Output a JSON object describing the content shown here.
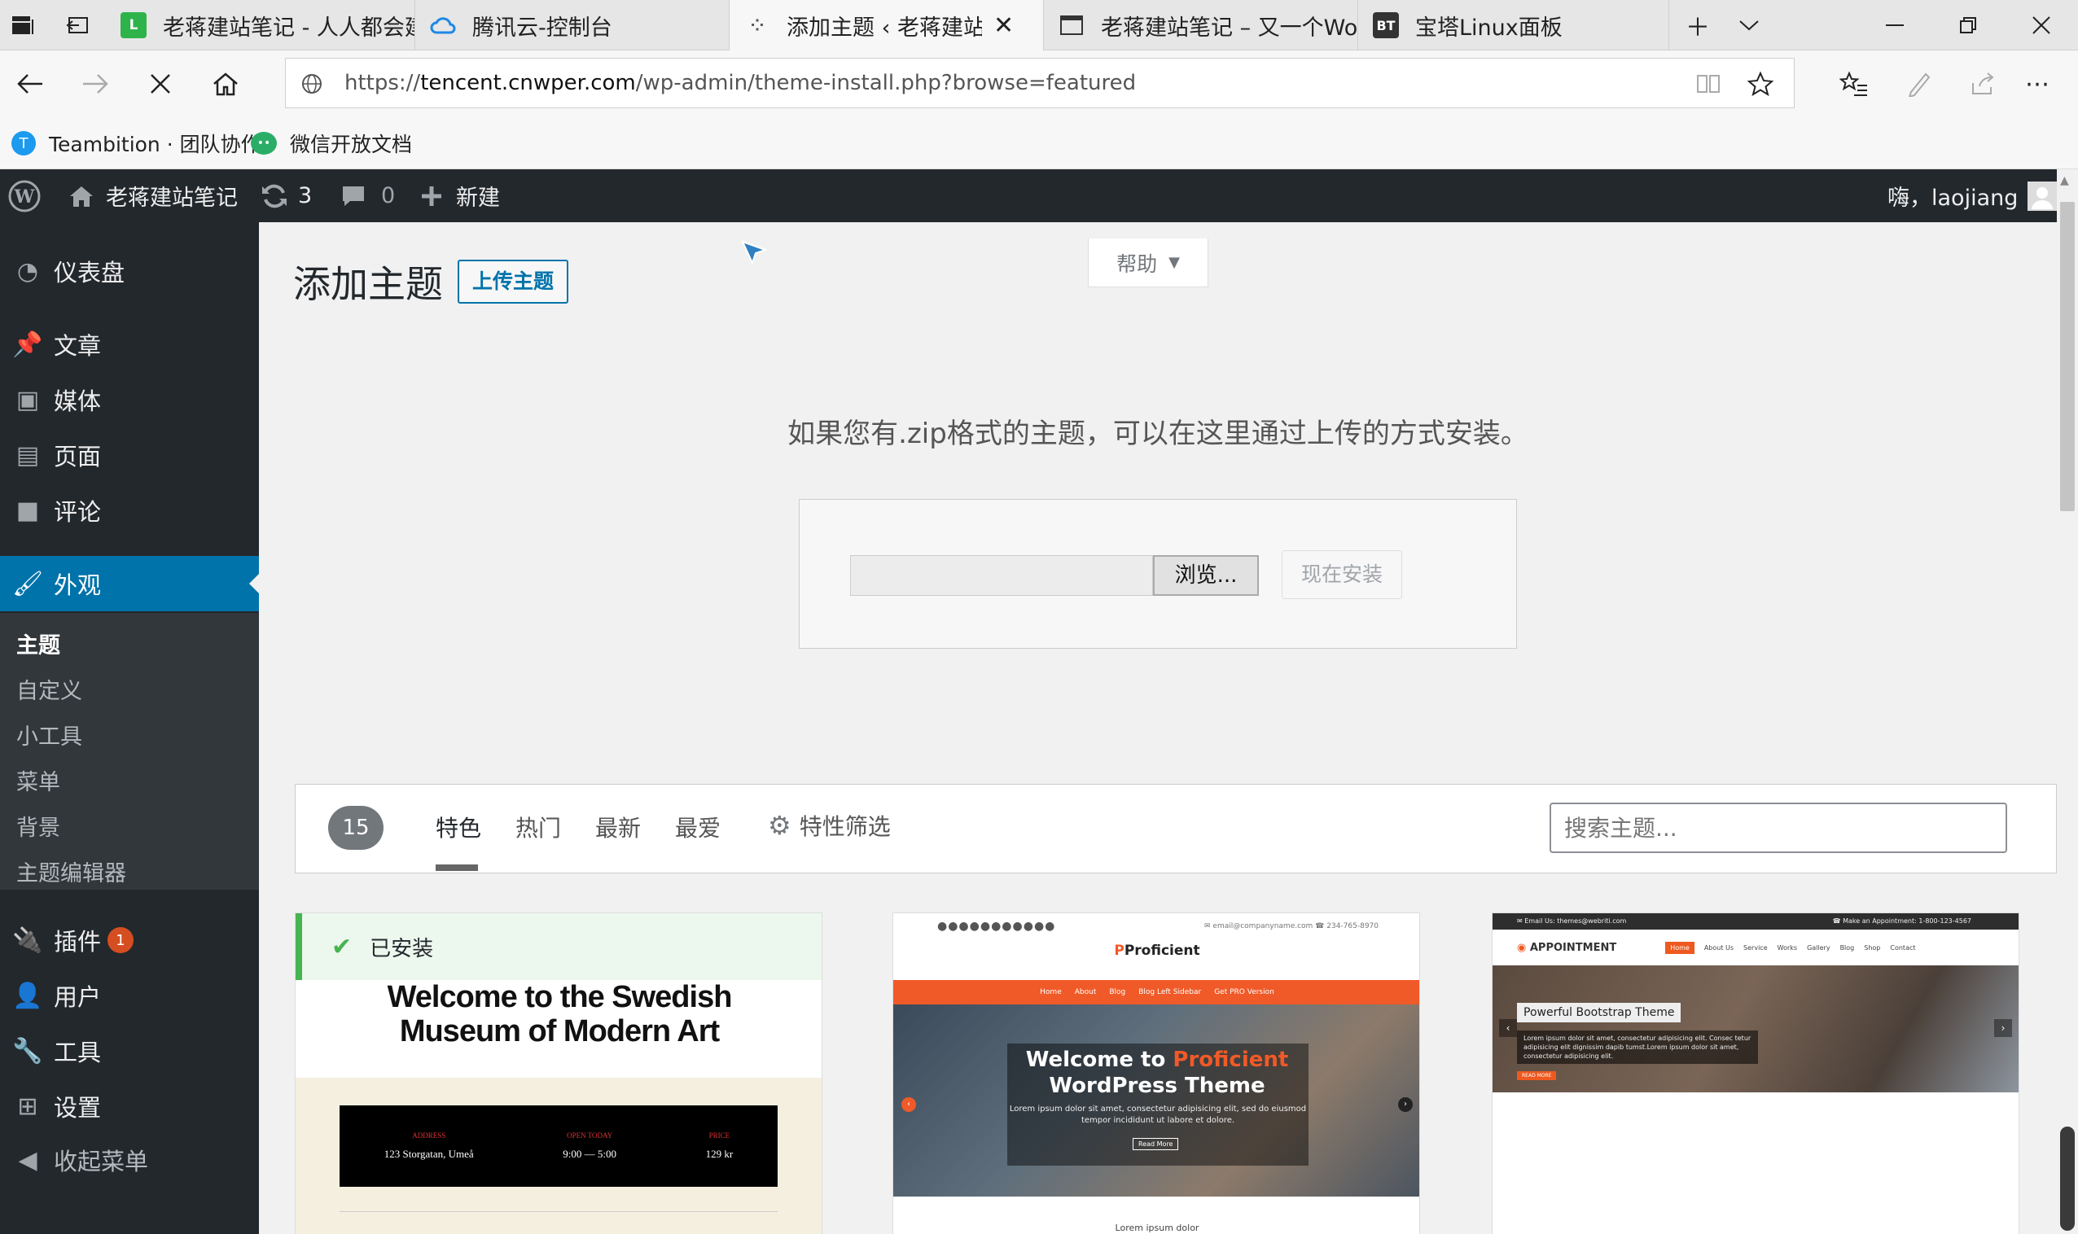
{
  "browser": {
    "tabs": [
      {
        "title": "老蒋建站笔记 - 人人都会建"
      },
      {
        "title": "腾讯云-控制台"
      },
      {
        "title": "添加主题 ‹ 老蒋建站笔"
      },
      {
        "title": "老蒋建站笔记 – 又一个Wo"
      },
      {
        "title": "宝塔Linux面板",
        "icon_text": "BT"
      }
    ],
    "url_prefix": "https://",
    "url_domain": "tencent.cnwper.com",
    "url_path": "/wp-admin/theme-install.php?browse=featured",
    "bookmarks": [
      "Teambition · 团队协作",
      "微信开放文档"
    ]
  },
  "adminbar": {
    "site_name": "老蒋建站笔记",
    "updates_count": "3",
    "comments_count": "0",
    "new_label": "新建",
    "greeting": "嗨，laojiang"
  },
  "sidebar": {
    "items": [
      "仪表盘",
      "文章",
      "媒体",
      "页面",
      "评论",
      "外观",
      "插件",
      "用户",
      "工具",
      "设置",
      "收起菜单"
    ],
    "plugins_badge": "1",
    "submenu": [
      "主题",
      "自定义",
      "小工具",
      "菜单",
      "背景",
      "主题编辑器"
    ]
  },
  "page": {
    "title": "添加主题",
    "upload_button": "上传主题",
    "help_button": "帮助",
    "upload_hint": "如果您有.zip格式的主题，可以在这里通过上传的方式安装。",
    "browse_button": "浏览...",
    "install_button": "现在安装"
  },
  "filter": {
    "count": "15",
    "tabs": [
      "特色",
      "热门",
      "最新",
      "最爱"
    ],
    "feature_filter": "特性筛选",
    "search_placeholder": "搜索主题..."
  },
  "themes": {
    "installed_label": "已安装",
    "t1_heading_1": "Welcome to the Swedish",
    "t1_heading_2": "Museum of Modern Art",
    "t1_info": [
      {
        "label": "ADDRESS",
        "value": "123 Storgatan, Umeå"
      },
      {
        "label": "OPEN TODAY",
        "value": "9:00 — 5:00"
      },
      {
        "label": "PRICE",
        "value": "129 kr"
      }
    ],
    "t2_logo": "Proficient",
    "t2_contact": "✉ email@companyname.com   ☎ 234-765-8970",
    "t2_menu": [
      "Home",
      "About",
      "Blog",
      "Blog Left Sidebar",
      "Get PRO Version"
    ],
    "t2_hero_1": "Welcome to ",
    "t2_hero_accent": "Proficient",
    "t2_hero_2": "WordPress Theme",
    "t2_hero_text": "Lorem ipsum dolor sit amet, consectetur adipisicing elit, sed do eiusmod tempor incididunt ut labore et dolore.",
    "t2_readmore": "Read More",
    "t2_footer_text": "Lorem ipsum dolor",
    "t3_topbar_left": "✉ Email Us: themes@webriti.com",
    "t3_topbar_right": "☎ Make an Appointment: 1-800-123-4567",
    "t3_logo": "APPOINTMENT",
    "t3_menu": [
      "Home",
      "About Us",
      "Service",
      "Works",
      "Gallery",
      "Blog",
      "Shop",
      "Contact"
    ],
    "t3_badge": "Powerful Bootstrap Theme",
    "t3_text": "Lorem ipsum dolor sit amet, consectetur adipisicing elit. Consec tetur adipisicing elit dignissim dapib tumst.Lorem ipsum dolor sit amet, consectetur adipisicing elit.",
    "t3_readmore": "READ MORE"
  },
  "colors": {
    "wp_dark": "#23282d",
    "wp_blue": "#0073aa",
    "proficient_orange": "#f05a28",
    "installed_green": "#46b450"
  }
}
